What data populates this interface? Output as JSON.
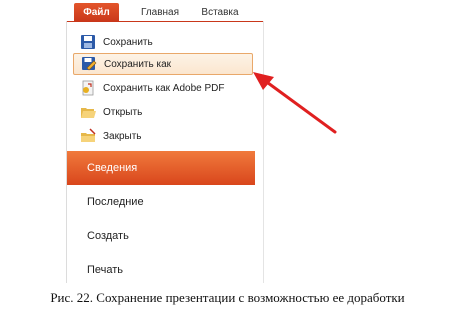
{
  "ribbon": {
    "tabs": [
      {
        "label": "Файл"
      },
      {
        "label": "Главная"
      },
      {
        "label": "Вставка"
      }
    ]
  },
  "menu": {
    "items": [
      {
        "label": "Сохранить",
        "icon": "save-icon"
      },
      {
        "label": "Сохранить как",
        "icon": "save-as-icon",
        "selected": true
      },
      {
        "label": "Сохранить как Adobe PDF",
        "icon": "pdf-icon"
      },
      {
        "label": "Открыть",
        "icon": "open-folder-icon"
      },
      {
        "label": "Закрыть",
        "icon": "close-folder-icon"
      }
    ],
    "sections": [
      {
        "label": "Сведения",
        "active": true
      },
      {
        "label": "Последние"
      },
      {
        "label": "Создать"
      },
      {
        "label": "Печать"
      }
    ]
  },
  "annotation": {
    "arrow_color": "#e02020"
  },
  "caption": "Рис. 22. Сохранение презентации с возможностью ее доработки"
}
